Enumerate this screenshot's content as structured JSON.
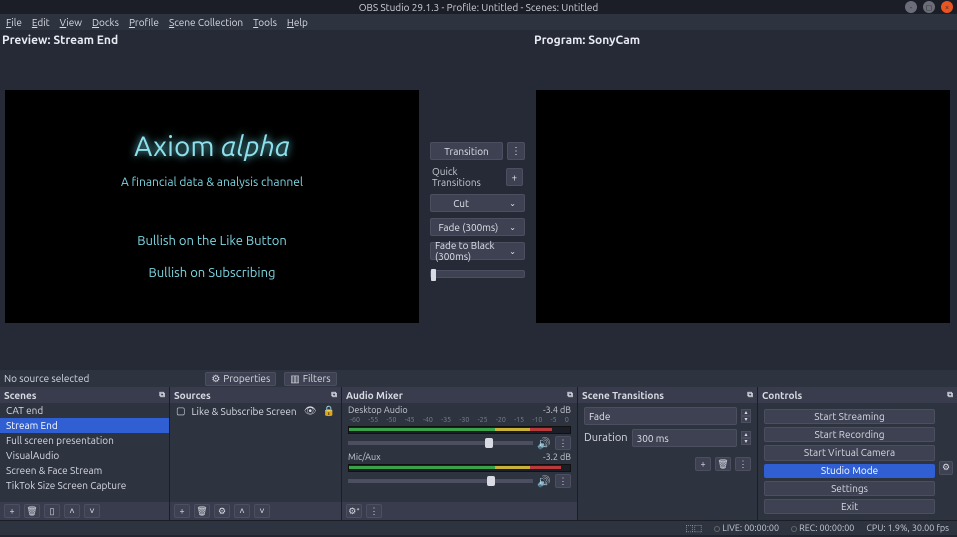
{
  "window": {
    "title": "OBS Studio 29.1.3 - Profile: Untitled - Scenes: Untitled"
  },
  "menu": {
    "file": "File",
    "edit": "Edit",
    "view": "View",
    "docks": "Docks",
    "profile": "Profile",
    "scene_collection": "Scene Collection",
    "tools": "Tools",
    "help": "Help"
  },
  "top": {
    "preview_label": "Preview: Stream End",
    "program_label": "Program: SonyCam",
    "slide": {
      "title_a": "Axiom ",
      "title_b": "αlpha",
      "subtitle": "A financial data & analysis channel",
      "line1": "Bullish on the Like Button",
      "line2": "Bullish on Subscribing"
    }
  },
  "center": {
    "transition_btn": "Transition",
    "quick_label": "Quick Transitions",
    "options": {
      "cut": "Cut",
      "fade": "Fade (300ms)",
      "fade_black": "Fade to Black (300ms)"
    }
  },
  "sourceinfo": {
    "none": "No source selected",
    "properties": "Properties",
    "filters": "Filters"
  },
  "scenes": {
    "title": "Scenes",
    "items": [
      "CAT end",
      "Stream End",
      "Full screen presentation",
      "VisualAudio",
      "Screen & Face Stream",
      "TikTok Size Screen Capture"
    ],
    "selected_index": 1
  },
  "sources": {
    "title": "Sources",
    "items": [
      {
        "label": "Like & Subscribe Screen"
      }
    ]
  },
  "mixer": {
    "title": "Audio Mixer",
    "scale": [
      "-60",
      "-55",
      "-50",
      "-45",
      "-40",
      "-35",
      "-30",
      "-25",
      "-20",
      "-15",
      "-10",
      "-5",
      "0"
    ],
    "ch0": {
      "name": "Desktop Audio",
      "level": "-3.4 dB"
    },
    "ch1": {
      "name": "Mic/Aux",
      "level": "-3.2 dB"
    }
  },
  "transitions": {
    "title": "Scene Transitions",
    "current": "Fade",
    "duration_label": "Duration",
    "duration_value": "300 ms"
  },
  "controls": {
    "title": "Controls",
    "start_streaming": "Start Streaming",
    "start_recording": "Start Recording",
    "virtual_cam": "Start Virtual Camera",
    "studio_mode": "Studio Mode",
    "settings": "Settings",
    "exit": "Exit"
  },
  "status": {
    "live": "LIVE: 00:00:00",
    "rec": "REC: 00:00:00",
    "cpu": "CPU: 1.9%, 30.00 fps"
  }
}
